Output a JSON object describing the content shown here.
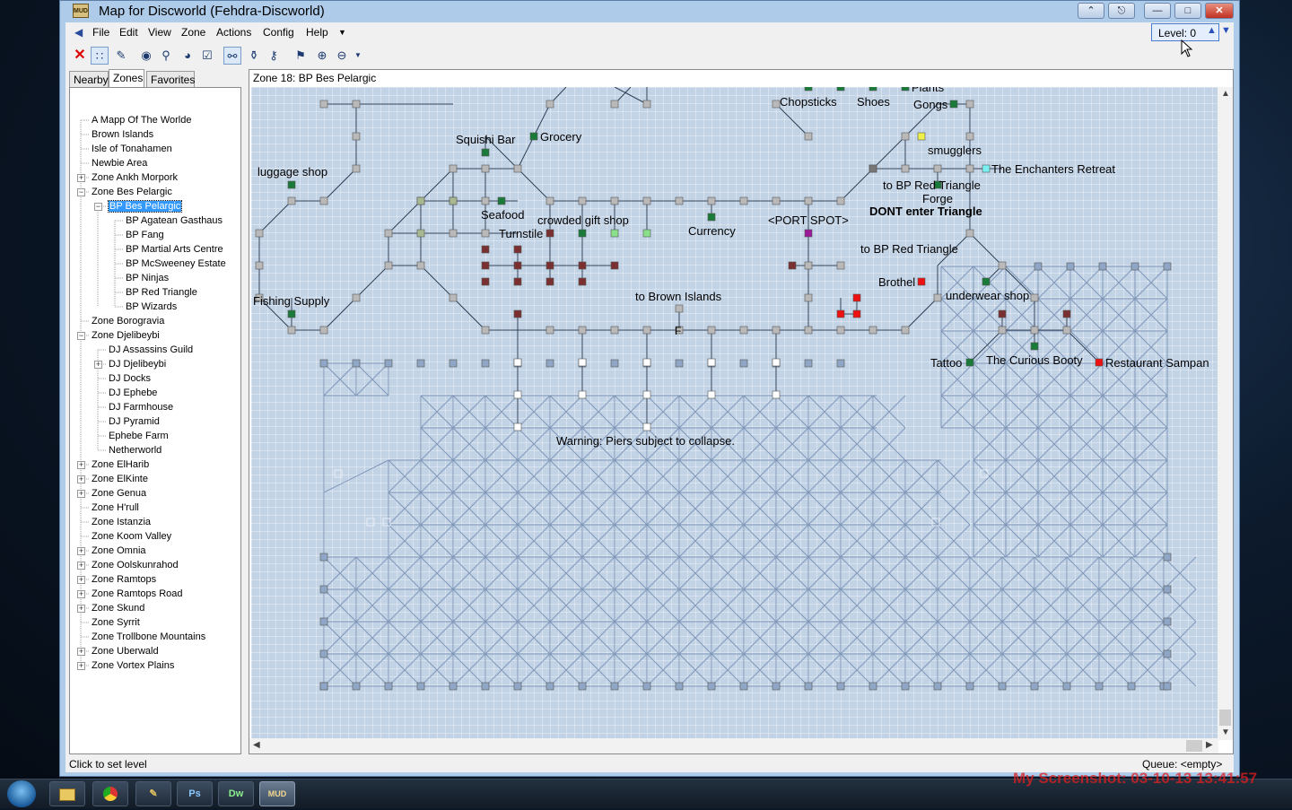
{
  "window": {
    "title": "Map for Discworld (Fehdra-Discworld)",
    "app_icon_text": "MUD",
    "title_buttons": [
      "restore-up",
      "pin",
      "minimize",
      "maximize",
      "close"
    ]
  },
  "menu": {
    "items": [
      "File",
      "Edit",
      "View",
      "Zone",
      "Actions",
      "Config",
      "Help"
    ],
    "level_label": "Level: 0"
  },
  "toolbar": {
    "icons": [
      "delete-icon",
      "grid-icon",
      "pen-icon",
      "binoculars-icon",
      "magnifier-icon",
      "find-icon",
      "checkbox-icon",
      "walk-icon",
      "walk-find-icon",
      "walk-run-icon",
      "map-marker-icon",
      "zoom-in-icon",
      "zoom-out-icon"
    ]
  },
  "tabs": [
    {
      "label": "Nearby",
      "selected": false
    },
    {
      "label": "Zones",
      "selected": true
    },
    {
      "label": "Favorites",
      "selected": false
    }
  ],
  "tree": [
    {
      "label": "A Mapp Of The Worlde",
      "depth": 0,
      "expander": ""
    },
    {
      "label": "Brown Islands",
      "depth": 0,
      "expander": ""
    },
    {
      "label": "Isle of Tonahamen",
      "depth": 0,
      "expander": ""
    },
    {
      "label": "Newbie Area",
      "depth": 0,
      "expander": ""
    },
    {
      "label": "Zone Ankh Morpork",
      "depth": 0,
      "expander": "+"
    },
    {
      "label": "Zone Bes Pelargic",
      "depth": 0,
      "expander": "-"
    },
    {
      "label": "BP Bes Pelargic",
      "depth": 1,
      "expander": "-",
      "selected": true
    },
    {
      "label": "BP Agatean Gasthaus",
      "depth": 2,
      "expander": ""
    },
    {
      "label": "BP Fang",
      "depth": 2,
      "expander": ""
    },
    {
      "label": "BP Martial Arts Centre",
      "depth": 2,
      "expander": ""
    },
    {
      "label": "BP McSweeney Estate",
      "depth": 2,
      "expander": ""
    },
    {
      "label": "BP Ninjas",
      "depth": 2,
      "expander": ""
    },
    {
      "label": "BP Red Triangle",
      "depth": 2,
      "expander": ""
    },
    {
      "label": "BP Wizards",
      "depth": 2,
      "expander": ""
    },
    {
      "label": "Zone Borogravia",
      "depth": 0,
      "expander": ""
    },
    {
      "label": "Zone Djelibeybi",
      "depth": 0,
      "expander": "-"
    },
    {
      "label": "DJ Assassins Guild",
      "depth": 1,
      "expander": ""
    },
    {
      "label": "DJ Djelibeybi",
      "depth": 1,
      "expander": "+"
    },
    {
      "label": "DJ Docks",
      "depth": 1,
      "expander": ""
    },
    {
      "label": "DJ Ephebe",
      "depth": 1,
      "expander": ""
    },
    {
      "label": "DJ Farmhouse",
      "depth": 1,
      "expander": ""
    },
    {
      "label": "DJ Pyramid",
      "depth": 1,
      "expander": ""
    },
    {
      "label": "Ephebe Farm",
      "depth": 1,
      "expander": ""
    },
    {
      "label": "Netherworld",
      "depth": 1,
      "expander": ""
    },
    {
      "label": "Zone ElHarib",
      "depth": 0,
      "expander": "+"
    },
    {
      "label": "Zone ElKinte",
      "depth": 0,
      "expander": "+"
    },
    {
      "label": "Zone Genua",
      "depth": 0,
      "expander": "+"
    },
    {
      "label": "Zone H'rull",
      "depth": 0,
      "expander": ""
    },
    {
      "label": "Zone Istanzia",
      "depth": 0,
      "expander": ""
    },
    {
      "label": "Zone Koom Valley",
      "depth": 0,
      "expander": ""
    },
    {
      "label": "Zone Omnia",
      "depth": 0,
      "expander": "+"
    },
    {
      "label": "Zone Oolskunrahod",
      "depth": 0,
      "expander": "+"
    },
    {
      "label": "Zone Ramtops",
      "depth": 0,
      "expander": "+"
    },
    {
      "label": "Zone Ramtops Road",
      "depth": 0,
      "expander": "+"
    },
    {
      "label": "Zone Skund",
      "depth": 0,
      "expander": "+"
    },
    {
      "label": "Zone Syrrit",
      "depth": 0,
      "expander": ""
    },
    {
      "label": "Zone Trollbone Mountains",
      "depth": 0,
      "expander": ""
    },
    {
      "label": "Zone Uberwald",
      "depth": 0,
      "expander": "+"
    },
    {
      "label": "Zone Vortex Plains",
      "depth": 0,
      "expander": "+"
    }
  ],
  "map": {
    "zone_header": "Zone 18: BP Bes Pelargic",
    "labels": [
      "Chopsticks",
      "Shoes",
      "Plants",
      "Gongs",
      "Squishi Bar",
      "Grocery",
      "smugglers",
      "luggage shop",
      "The Enchanters Retreat",
      "to BP Red Triangle",
      "Forge",
      "DONT enter Triangle",
      "Seafood",
      "crowded gift shop",
      "Turnstile",
      "Currency",
      "<PORT SPOT>",
      "to BP Red Triangle",
      "Brothel",
      "underwear shop",
      "Fishing Supply",
      "to Brown Islands",
      "Tattoo",
      "The Curious Booty",
      "Restaurant Sampan",
      "Warning: Piers subject to collapse."
    ],
    "room_colors": {
      "default": "#b9b9b9",
      "shop": "#1a7a3a",
      "danger": "#ee1111",
      "warehouse": "#7a3030",
      "port": "#9a1a9a",
      "highlight": "#f0f04a",
      "enchant": "#7af0f0",
      "light": "#8ae08a",
      "pier": "#ffffff"
    }
  },
  "status": {
    "left": "Click to set level",
    "right": "Queue: <empty>"
  },
  "taskbar": {
    "apps": [
      "explorer-icon",
      "chrome-icon",
      "tool-icon",
      "photoshop-icon",
      "dreamweaver-icon",
      "mud-icon"
    ],
    "app_text": [
      "",
      "",
      "",
      "Ps",
      "Dw",
      "MUD"
    ]
  },
  "watermark": "My Screenshot: 03-10-13 13:41:57"
}
